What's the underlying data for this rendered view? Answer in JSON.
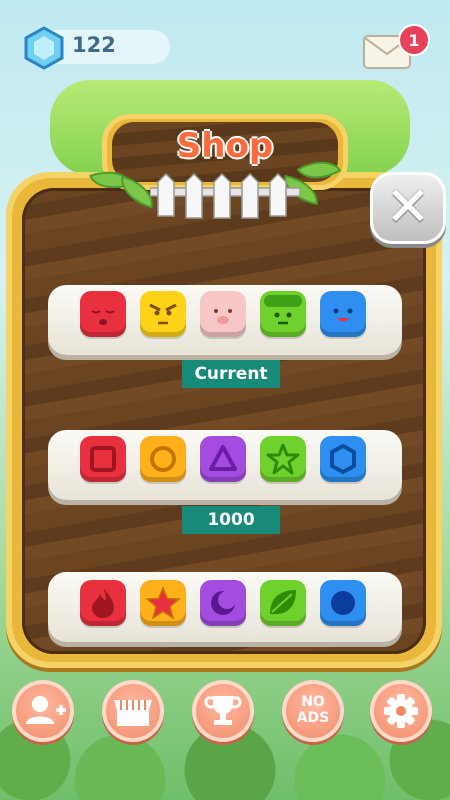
{
  "header": {
    "gem_count": "122",
    "mail_badge": "1"
  },
  "shop": {
    "title": "Shop",
    "rows": [
      {
        "label": "Current",
        "pieces": [
          {
            "name": "red-face-piece",
            "color": "#e8303f",
            "icon": "sleepy-face"
          },
          {
            "name": "yellow-face-piece",
            "color": "#ffd21a",
            "icon": "angry-face"
          },
          {
            "name": "pink-face-piece",
            "color": "#f7c6c6",
            "icon": "pig-face"
          },
          {
            "name": "green-face-piece",
            "color": "#6fd12c",
            "icon": "smile-face"
          },
          {
            "name": "blue-face-piece",
            "color": "#2f8ff0",
            "icon": "happy-face"
          }
        ]
      },
      {
        "label": "1000",
        "pieces": [
          {
            "name": "red-square-piece",
            "color": "#e8303f",
            "icon": "square-icon"
          },
          {
            "name": "yellow-circle-piece",
            "color": "#ffb01a",
            "icon": "circle-icon"
          },
          {
            "name": "purple-triangle-piece",
            "color": "#a44be0",
            "icon": "triangle-icon"
          },
          {
            "name": "green-star-piece",
            "color": "#6fd12c",
            "icon": "star-outline-icon"
          },
          {
            "name": "blue-hexagon-piece",
            "color": "#2f8ff0",
            "icon": "hexagon-icon"
          }
        ]
      },
      {
        "label": "",
        "pieces": [
          {
            "name": "red-flame-piece",
            "color": "#e8303f",
            "icon": "flame-icon"
          },
          {
            "name": "yellow-star-piece",
            "color": "#ffb01a",
            "icon": "star-icon"
          },
          {
            "name": "purple-moon-piece",
            "color": "#a44be0",
            "icon": "moon-icon"
          },
          {
            "name": "green-leaf-piece",
            "color": "#6fd12c",
            "icon": "leaf-icon"
          },
          {
            "name": "blue-ball-piece",
            "color": "#2f8ff0",
            "icon": "ball-icon"
          }
        ]
      }
    ]
  },
  "nav": {
    "no_ads_line1": "NO",
    "no_ads_line2": "ADS",
    "buttons": [
      "add-friend-icon",
      "store-icon",
      "trophy-icon",
      "no-ads",
      "gear-icon"
    ]
  }
}
